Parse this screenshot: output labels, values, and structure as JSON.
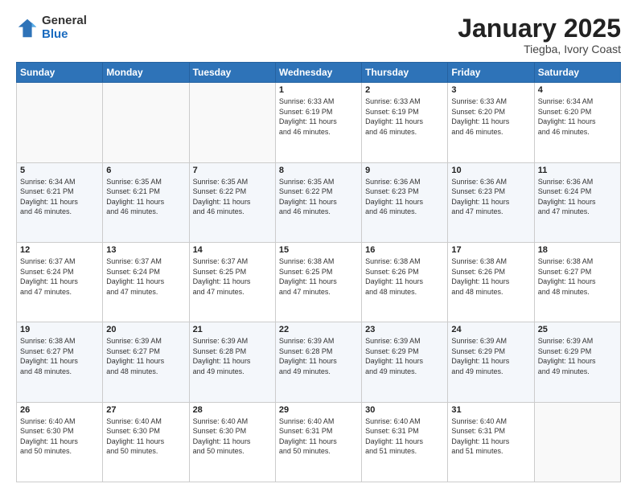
{
  "logo": {
    "general": "General",
    "blue": "Blue"
  },
  "title": {
    "month": "January 2025",
    "location": "Tiegba, Ivory Coast"
  },
  "days_header": [
    "Sunday",
    "Monday",
    "Tuesday",
    "Wednesday",
    "Thursday",
    "Friday",
    "Saturday"
  ],
  "weeks": [
    [
      {
        "day": "",
        "info": ""
      },
      {
        "day": "",
        "info": ""
      },
      {
        "day": "",
        "info": ""
      },
      {
        "day": "1",
        "info": "Sunrise: 6:33 AM\nSunset: 6:19 PM\nDaylight: 11 hours\nand 46 minutes."
      },
      {
        "day": "2",
        "info": "Sunrise: 6:33 AM\nSunset: 6:19 PM\nDaylight: 11 hours\nand 46 minutes."
      },
      {
        "day": "3",
        "info": "Sunrise: 6:33 AM\nSunset: 6:20 PM\nDaylight: 11 hours\nand 46 minutes."
      },
      {
        "day": "4",
        "info": "Sunrise: 6:34 AM\nSunset: 6:20 PM\nDaylight: 11 hours\nand 46 minutes."
      }
    ],
    [
      {
        "day": "5",
        "info": "Sunrise: 6:34 AM\nSunset: 6:21 PM\nDaylight: 11 hours\nand 46 minutes."
      },
      {
        "day": "6",
        "info": "Sunrise: 6:35 AM\nSunset: 6:21 PM\nDaylight: 11 hours\nand 46 minutes."
      },
      {
        "day": "7",
        "info": "Sunrise: 6:35 AM\nSunset: 6:22 PM\nDaylight: 11 hours\nand 46 minutes."
      },
      {
        "day": "8",
        "info": "Sunrise: 6:35 AM\nSunset: 6:22 PM\nDaylight: 11 hours\nand 46 minutes."
      },
      {
        "day": "9",
        "info": "Sunrise: 6:36 AM\nSunset: 6:23 PM\nDaylight: 11 hours\nand 46 minutes."
      },
      {
        "day": "10",
        "info": "Sunrise: 6:36 AM\nSunset: 6:23 PM\nDaylight: 11 hours\nand 47 minutes."
      },
      {
        "day": "11",
        "info": "Sunrise: 6:36 AM\nSunset: 6:24 PM\nDaylight: 11 hours\nand 47 minutes."
      }
    ],
    [
      {
        "day": "12",
        "info": "Sunrise: 6:37 AM\nSunset: 6:24 PM\nDaylight: 11 hours\nand 47 minutes."
      },
      {
        "day": "13",
        "info": "Sunrise: 6:37 AM\nSunset: 6:24 PM\nDaylight: 11 hours\nand 47 minutes."
      },
      {
        "day": "14",
        "info": "Sunrise: 6:37 AM\nSunset: 6:25 PM\nDaylight: 11 hours\nand 47 minutes."
      },
      {
        "day": "15",
        "info": "Sunrise: 6:38 AM\nSunset: 6:25 PM\nDaylight: 11 hours\nand 47 minutes."
      },
      {
        "day": "16",
        "info": "Sunrise: 6:38 AM\nSunset: 6:26 PM\nDaylight: 11 hours\nand 48 minutes."
      },
      {
        "day": "17",
        "info": "Sunrise: 6:38 AM\nSunset: 6:26 PM\nDaylight: 11 hours\nand 48 minutes."
      },
      {
        "day": "18",
        "info": "Sunrise: 6:38 AM\nSunset: 6:27 PM\nDaylight: 11 hours\nand 48 minutes."
      }
    ],
    [
      {
        "day": "19",
        "info": "Sunrise: 6:38 AM\nSunset: 6:27 PM\nDaylight: 11 hours\nand 48 minutes."
      },
      {
        "day": "20",
        "info": "Sunrise: 6:39 AM\nSunset: 6:27 PM\nDaylight: 11 hours\nand 48 minutes."
      },
      {
        "day": "21",
        "info": "Sunrise: 6:39 AM\nSunset: 6:28 PM\nDaylight: 11 hours\nand 49 minutes."
      },
      {
        "day": "22",
        "info": "Sunrise: 6:39 AM\nSunset: 6:28 PM\nDaylight: 11 hours\nand 49 minutes."
      },
      {
        "day": "23",
        "info": "Sunrise: 6:39 AM\nSunset: 6:29 PM\nDaylight: 11 hours\nand 49 minutes."
      },
      {
        "day": "24",
        "info": "Sunrise: 6:39 AM\nSunset: 6:29 PM\nDaylight: 11 hours\nand 49 minutes."
      },
      {
        "day": "25",
        "info": "Sunrise: 6:39 AM\nSunset: 6:29 PM\nDaylight: 11 hours\nand 49 minutes."
      }
    ],
    [
      {
        "day": "26",
        "info": "Sunrise: 6:40 AM\nSunset: 6:30 PM\nDaylight: 11 hours\nand 50 minutes."
      },
      {
        "day": "27",
        "info": "Sunrise: 6:40 AM\nSunset: 6:30 PM\nDaylight: 11 hours\nand 50 minutes."
      },
      {
        "day": "28",
        "info": "Sunrise: 6:40 AM\nSunset: 6:30 PM\nDaylight: 11 hours\nand 50 minutes."
      },
      {
        "day": "29",
        "info": "Sunrise: 6:40 AM\nSunset: 6:31 PM\nDaylight: 11 hours\nand 50 minutes."
      },
      {
        "day": "30",
        "info": "Sunrise: 6:40 AM\nSunset: 6:31 PM\nDaylight: 11 hours\nand 51 minutes."
      },
      {
        "day": "31",
        "info": "Sunrise: 6:40 AM\nSunset: 6:31 PM\nDaylight: 11 hours\nand 51 minutes."
      },
      {
        "day": "",
        "info": ""
      }
    ]
  ]
}
